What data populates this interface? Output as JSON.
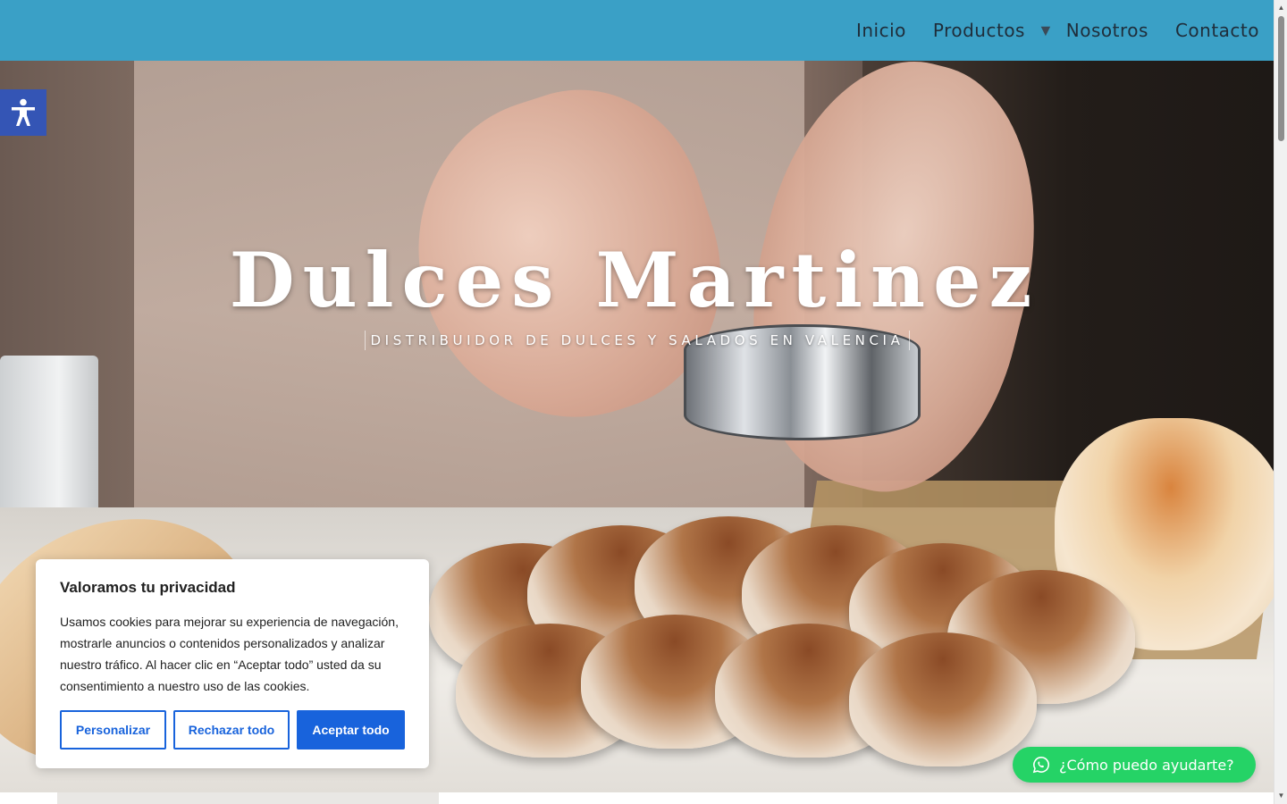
{
  "nav": {
    "items": [
      {
        "label": "Inicio"
      },
      {
        "label": "Productos"
      },
      {
        "label": "Nosotros"
      },
      {
        "label": "Contacto"
      }
    ],
    "dropdown_icon": "▼"
  },
  "hero": {
    "title": "Dulces Martinez",
    "subtitle": "DISTRIBUIDOR DE DULCES Y SALADOS EN VALENCIA"
  },
  "accessibility": {
    "icon": "accessibility-icon"
  },
  "cookie_banner": {
    "title": "Valoramos tu privacidad",
    "text": "Usamos cookies para mejorar su experiencia de navegación, mostrarle anuncios o contenidos personalizados y analizar nuestro tráfico. Al hacer clic en “Aceptar todo” usted da su consentimiento a nuestro uso de las cookies.",
    "customize_label": "Personalizar",
    "reject_label": "Rechazar todo",
    "accept_label": "Aceptar todo"
  },
  "whatsapp": {
    "label": "¿Cómo puedo ayudarte?",
    "icon": "whatsapp-icon"
  },
  "colors": {
    "header": "#3aa0c6",
    "accent_blue": "#1863dc",
    "whatsapp_green": "#25d366",
    "a11y_blue": "#3455b5"
  }
}
